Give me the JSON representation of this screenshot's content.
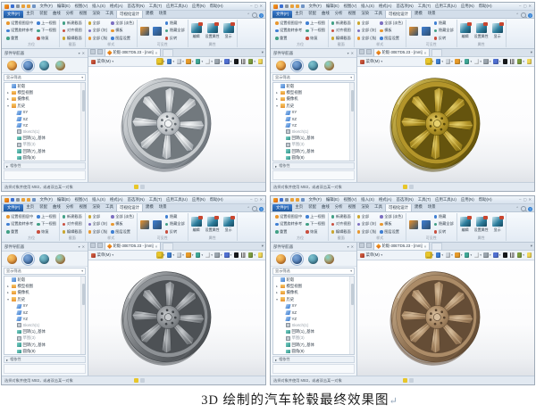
{
  "caption": {
    "text": "3D 绘制的汽车轮毂最终效果图",
    "return_mark": "↵"
  },
  "chrome": {
    "titlebar": {
      "quick_access_icons": [
        {
          "name": "save-icon",
          "color": "#3b6fd0"
        },
        {
          "name": "print-icon",
          "color": "#8a939c"
        },
        {
          "name": "undo-icon",
          "color": "#e8a13a"
        },
        {
          "name": "redo-icon",
          "color": "#e8a13a"
        },
        {
          "name": "repeat-command-icon",
          "color": "#6f93c4"
        }
      ],
      "menus": [
        "文件(F)",
        "编辑(E)",
        "视图(V)",
        "插入(S)",
        "格式(A)",
        "首选项(N)",
        "工具(T)",
        "应用工具(U)",
        "应用(N)",
        "帮助(H)"
      ],
      "window_controls": [
        {
          "name": "minimize",
          "glyph": "‒"
        },
        {
          "name": "maximize",
          "glyph": "▢"
        },
        {
          "name": "close",
          "glyph": "✕"
        }
      ]
    },
    "ribbon": {
      "file_tab": "文件(F)",
      "tabs": [
        "主页",
        "装配",
        "曲线",
        "分析",
        "视图",
        "渲染",
        "工具",
        "可视化设计",
        "建模",
        "场景"
      ],
      "active_tab": "可视化设计",
      "groups": [
        {
          "label": "方位",
          "cols": [
            [
              "设置视图居中",
              "设置旋转参考",
              "重置"
            ],
            [
              "上一视图",
              "下一视图",
              "恢复"
            ]
          ]
        },
        {
          "label": "截面",
          "cols": [
            [
              "新建截面",
              "对齐视图",
              "编辑截面"
            ]
          ]
        },
        {
          "label": "样式",
          "cols": [
            [
              "全部",
              "全部 (灰)",
              "全部 (浅)"
            ],
            [
              "全部 (淡色)",
              "模板",
              "图层设置"
            ]
          ]
        },
        {
          "label": "可见性",
          "big": [
            {
              "name": "show-icon",
              "color": "#e8932f"
            },
            {
              "name": "hide-icon",
              "color": "#3f7fd2"
            }
          ],
          "col": [
            "隐藏",
            "隐藏全部",
            "反转"
          ]
        },
        {
          "label": "属性",
          "items": [
            "编辑",
            "设置属性",
            "显示"
          ]
        }
      ],
      "right_controls": {
        "collapse_glyph": "⌃",
        "help_glyph": "?"
      }
    },
    "panel": {
      "title": "部件导航器",
      "controls": [
        {
          "name": "panel-menu-icon",
          "glyph": "▾"
        },
        {
          "name": "panel-close-icon",
          "glyph": "✕"
        }
      ],
      "resource_tabs": [
        {
          "name": "history-browser-icon",
          "color1": "#f6c96a",
          "color2": "#d9731f"
        },
        {
          "name": "assembly-navigator-icon",
          "color1": "#7fa8d8",
          "color2": "#2f5f9e"
        },
        {
          "name": "constraint-navigator-icon",
          "color1": "#7fc4cf",
          "color2": "#2e6f8e"
        },
        {
          "name": "part-navigator-icon",
          "color1": "#7fd4c9",
          "color2": "#d9731f"
        }
      ],
      "filter_label": "显示筛选",
      "tree": [
        {
          "t": "轮毂",
          "icon": "part",
          "lvl": 0
        },
        {
          "t": "模型视图",
          "icon": "folder",
          "lvl": 0,
          "exp": "▸"
        },
        {
          "t": "摄像机",
          "icon": "folder",
          "lvl": 0,
          "exp": "▸"
        },
        {
          "t": "历史",
          "icon": "folder",
          "lvl": 0,
          "exp": "▾"
        },
        {
          "t": "XY",
          "icon": "datum",
          "lvl": 1
        },
        {
          "t": "XZ",
          "icon": "datum",
          "lvl": 1
        },
        {
          "t": "YZ",
          "icon": "datum",
          "lvl": 1
        },
        {
          "t": "Sketch(1)",
          "icon": "sketch",
          "lvl": 1
        },
        {
          "t": "回转(1)_基体",
          "icon": "feature",
          "lvl": 1
        },
        {
          "t": "草图(3)",
          "icon": "sketch",
          "lvl": 1
        },
        {
          "t": "回转(7)_基体",
          "icon": "feature",
          "lvl": 1
        },
        {
          "t": "圆角(8)",
          "icon": "feature",
          "lvl": 1
        },
        {
          "t": "草图(9)",
          "icon": "sketch",
          "lvl": 1
        },
        {
          "t": "拉伸(15)_阵列",
          "icon": "feature",
          "lvl": 1
        },
        {
          "t": "阵列(11)",
          "icon": "pattern",
          "lvl": 1
        },
        {
          "t": "阵列(12)",
          "icon": "feature",
          "lvl": 1
        }
      ],
      "dependencies": {
        "glyph": "▸",
        "label": "相依性"
      }
    },
    "viewport": {
      "doc_tab": "轮毂-30ETD5.23 - [mm]",
      "close_glyph": "×",
      "tab_overflow_glyph": "▾",
      "menu_button": "菜单(M)",
      "menu_caret": "▾",
      "toolbar_icons": [
        {
          "name": "snap-point-icon",
          "color": "#e8c62a",
          "caret": true,
          "highlight": true
        },
        {
          "name": "orient-view-icon",
          "color": "#3f7fd2",
          "caret": true
        },
        {
          "name": "window-display-icon",
          "color": "#cfd6dd",
          "caret": true
        },
        {
          "name": "shaded-style-icon",
          "color": "#e59a2a",
          "caret": true
        },
        {
          "name": "rendering-style-icon",
          "color": "#3fa796",
          "caret": true
        },
        {
          "name": "layout-icon",
          "color": "#eef3f8",
          "caret": true
        },
        {
          "name": "annotation-icon",
          "color": "#9aa4ad",
          "caret": true
        },
        {
          "name": "datum-display-icon",
          "color": "#4f6fd0",
          "caret": true
        },
        {
          "name": "background-black-icon",
          "color": "#17191c",
          "caret": false
        },
        {
          "name": "background-striped-icon",
          "color": "striped",
          "caret": false
        },
        {
          "name": "material-sphere-icon",
          "color": "#7c9c3f",
          "caret": true
        },
        {
          "name": "find-icon",
          "color": "#f0d75a",
          "caret": false
        }
      ]
    },
    "statusbar": {
      "prompt": "选择对象并使用 MB3，或者双击某一对象",
      "icons": [
        {
          "name": "cue-icon",
          "color": "#e8c62a"
        },
        {
          "name": "tips-icon",
          "color": "#c7d1dc"
        }
      ]
    }
  },
  "windows": [
    {
      "id": "top-left",
      "wheel_finish": "silver",
      "wheel_colors": {
        "base": "#c6cacd",
        "mid": "#9aa0a6",
        "dark": "#5f666d",
        "light": "#f2f4f5"
      }
    },
    {
      "id": "top-right",
      "wheel_finish": "gold",
      "wheel_colors": {
        "base": "#b3952a",
        "mid": "#8d7616",
        "dark": "#544608",
        "light": "#e6d06c"
      }
    },
    {
      "id": "bottom-left",
      "wheel_finish": "gunmetal",
      "wheel_colors": {
        "base": "#8d9195",
        "mid": "#6b6f73",
        "dark": "#3f4347",
        "light": "#c6c9cc"
      }
    },
    {
      "id": "bottom-right",
      "wheel_finish": "bronze",
      "wheel_colors": {
        "base": "#ab8b67",
        "mid": "#8a6c4d",
        "dark": "#55402c",
        "light": "#d6bd9c"
      }
    }
  ]
}
